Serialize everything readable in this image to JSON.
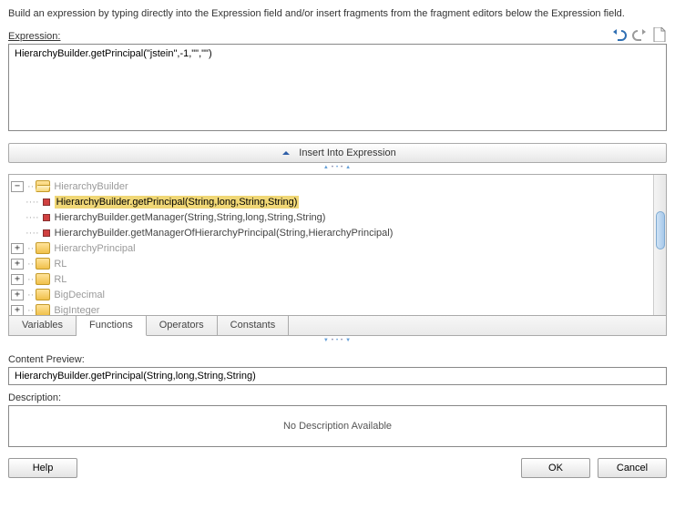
{
  "instruction": "Build an expression by typing directly into the Expression field and/or insert fragments from the fragment editors below the Expression field.",
  "labels": {
    "expression": "Expression:",
    "insert": "Insert Into Expression",
    "content_preview": "Content Preview:",
    "description": "Description:"
  },
  "expression_value": "HierarchyBuilder.getPrincipal(\"jstein\",-1,\"\",\"\")",
  "toolbar": {
    "undo_icon": "undo-icon",
    "redo_icon": "redo-icon",
    "new_icon": "new-page-icon"
  },
  "tree": {
    "root": {
      "label": "HierarchyBuilder",
      "expanded": true,
      "children": [
        {
          "label": "HierarchyBuilder.getPrincipal(String,long,String,String)",
          "selected": true
        },
        {
          "label": "HierarchyBuilder.getManager(String,String,long,String,String)"
        },
        {
          "label": "HierarchyBuilder.getManagerOfHierarchyPrincipal(String,HierarchyPrincipal)"
        }
      ]
    },
    "siblings": [
      {
        "label": "HierarchyPrincipal"
      },
      {
        "label": "RL"
      },
      {
        "label": "RL"
      },
      {
        "label": "BigDecimal"
      },
      {
        "label": "BigInteger"
      }
    ]
  },
  "tabs": [
    {
      "label": "Variables",
      "active": false
    },
    {
      "label": "Functions",
      "active": true
    },
    {
      "label": "Operators",
      "active": false
    },
    {
      "label": "Constants",
      "active": false
    }
  ],
  "content_preview_value": "HierarchyBuilder.getPrincipal(String,long,String,String)",
  "description_text": "No Description Available",
  "buttons": {
    "help": "Help",
    "ok": "OK",
    "cancel": "Cancel"
  }
}
